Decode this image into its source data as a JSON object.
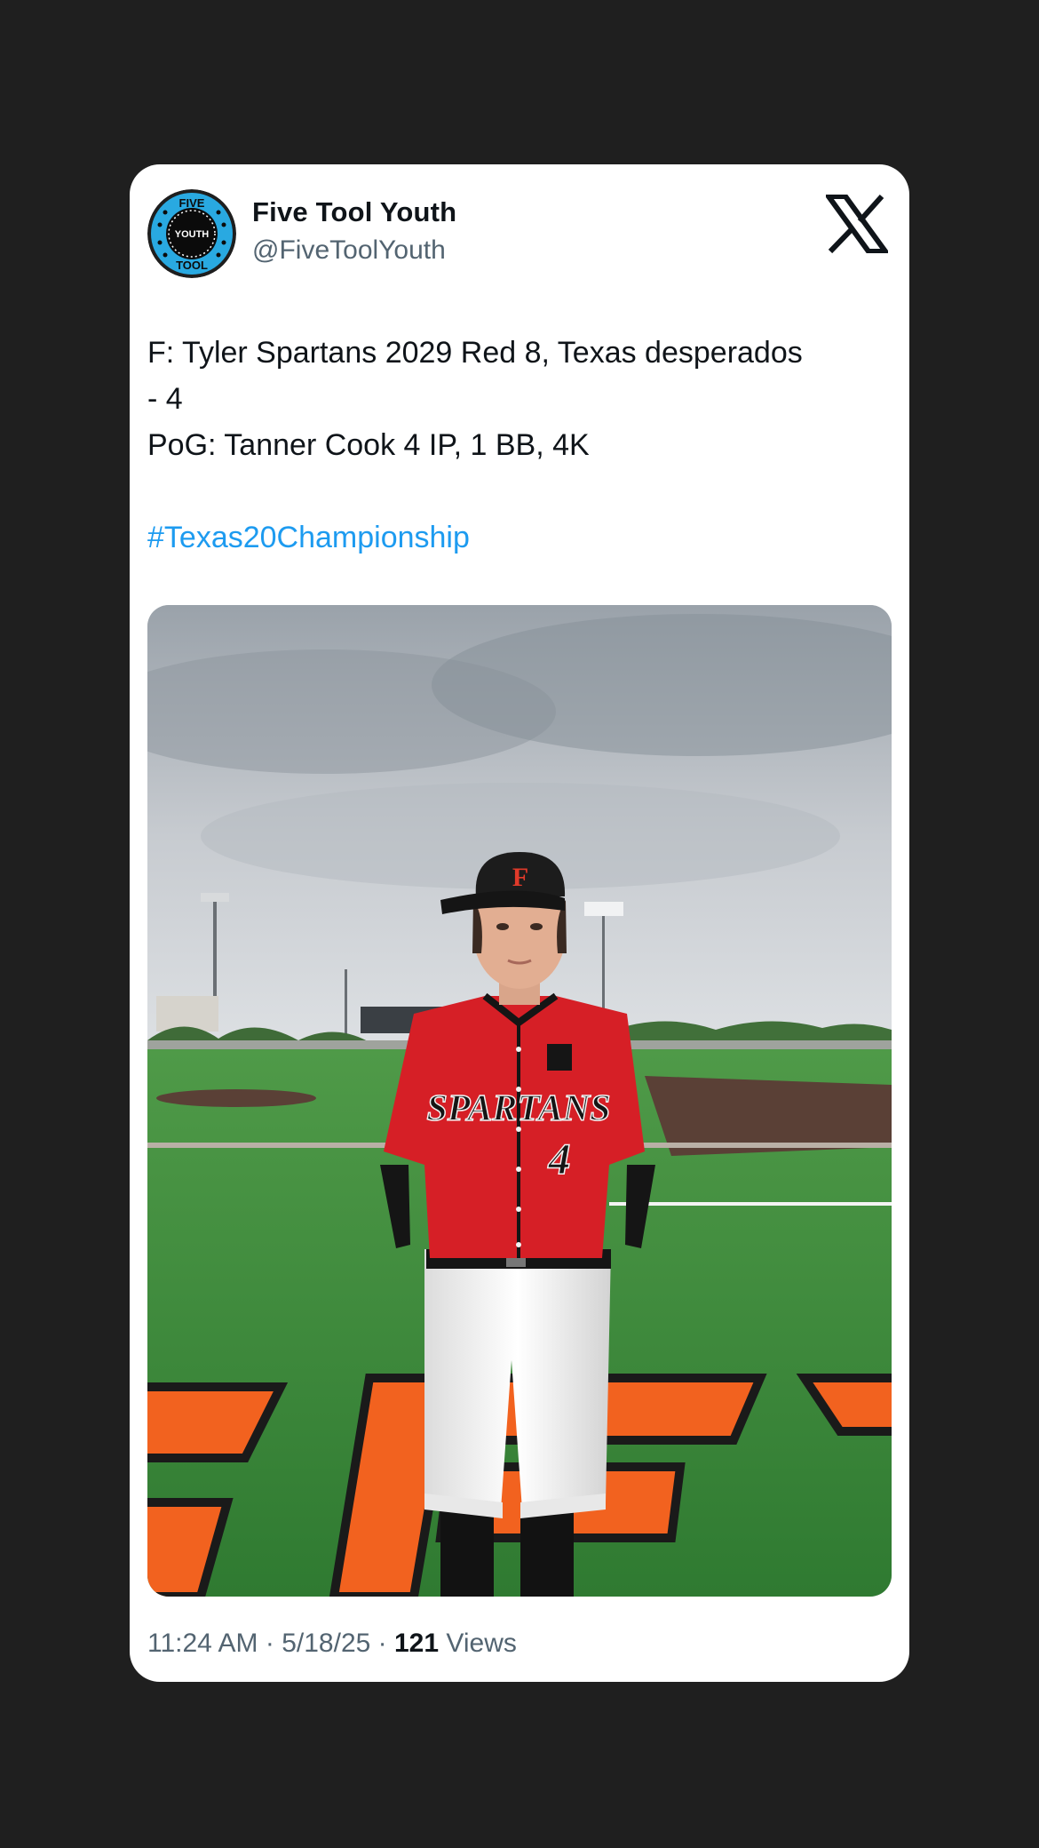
{
  "tweet": {
    "display_name": "Five Tool Youth",
    "handle": "@FiveToolYouth",
    "avatar": {
      "icon": "five-tool-youth-logo",
      "text_top": "FIVE",
      "text_center": "YOUTH",
      "text_bottom": "TOOL",
      "colors": {
        "ring": "#29a9e1",
        "center": "#0b0b0b"
      }
    },
    "platform_icon": "x-logo-icon",
    "text_lines": [
      "F: Tyler Spartans 2029 Red 8, Texas desperados",
      "- 4",
      "PoG: Tanner Cook 4 IP, 1 BB, 4K"
    ],
    "hashtag": "#Texas20Championship",
    "media": {
      "icon": "baseball-player-photo",
      "jersey_text": "SPARTANS",
      "jersey_number": "4",
      "colors": {
        "jersey": "#d61f26",
        "turf": "#3f8f3c",
        "infield": "#5a4036",
        "logo": "#f2621f"
      }
    },
    "time": "11:24 AM",
    "date": "5/18/25",
    "views_count": "121",
    "views_label": "Views",
    "separator": "·"
  },
  "colors": {
    "background": "#1f1f1f",
    "card": "#ffffff",
    "primary_text": "#0f1419",
    "secondary_text": "#536471",
    "link": "#1d9bf0"
  }
}
